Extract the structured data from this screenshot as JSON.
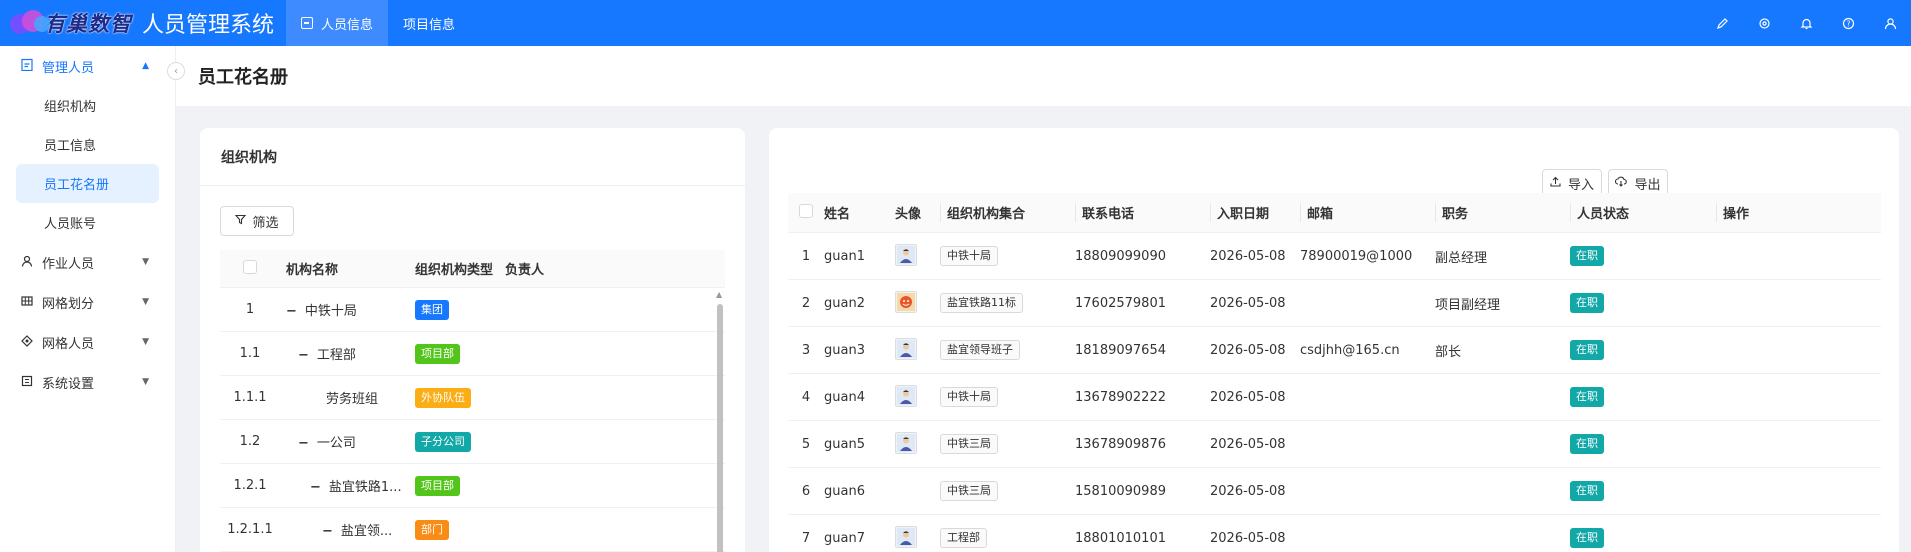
{
  "header": {
    "logo_text": "有巢数智",
    "app_title": "人员管理系统",
    "tabs": [
      {
        "label": "人员信息",
        "active": true
      },
      {
        "label": "项目信息",
        "active": false
      }
    ],
    "icons": [
      "pen-icon",
      "gear-icon",
      "bell-icon",
      "help-icon",
      "user-icon"
    ]
  },
  "sidebar": {
    "groups": [
      {
        "label": "管理人员",
        "icon": "clipboard-icon",
        "open": true,
        "items": [
          {
            "label": "组织机构",
            "active": false
          },
          {
            "label": "员工信息",
            "active": false
          },
          {
            "label": "员工花名册",
            "active": true
          },
          {
            "label": "人员账号",
            "active": false
          }
        ]
      },
      {
        "label": "作业人员",
        "icon": "person-icon",
        "open": false
      },
      {
        "label": "网格划分",
        "icon": "grid-icon",
        "open": false
      },
      {
        "label": "网格人员",
        "icon": "network-icon",
        "open": false
      },
      {
        "label": "系统设置",
        "icon": "settings-icon",
        "open": false
      }
    ]
  },
  "page": {
    "title": "员工花名册"
  },
  "org_panel": {
    "title": "组织机构",
    "filter_label": "筛选",
    "columns": [
      "机构名称",
      "组织机构类型",
      "负责人"
    ],
    "rows": [
      {
        "index": "1",
        "name": "中铁十局",
        "level": 0,
        "expandable": true,
        "type": "集团",
        "type_color": "#1677ff",
        "owner": ""
      },
      {
        "index": "1.1",
        "name": "工程部",
        "level": 1,
        "expandable": true,
        "type": "项目部",
        "type_color": "#52c41a",
        "owner": ""
      },
      {
        "index": "1.1.1",
        "name": "劳务班组",
        "level": 2,
        "expandable": false,
        "type": "外协队伍",
        "type_color": "#faad14",
        "owner": ""
      },
      {
        "index": "1.2",
        "name": "一公司",
        "level": 1,
        "expandable": true,
        "type": "子分公司",
        "type_color": "#13a8a8",
        "owner": ""
      },
      {
        "index": "1.2.1",
        "name": "盐宜铁路1...",
        "level": 2,
        "expandable": true,
        "type": "项目部",
        "type_color": "#52c41a",
        "owner": ""
      },
      {
        "index": "1.2.1.1",
        "name": "盐宜领...",
        "level": 3,
        "expandable": true,
        "type": "部门",
        "type_color": "#fa8c16",
        "owner": ""
      }
    ]
  },
  "employee_panel": {
    "import_label": "导入",
    "export_label": "导出",
    "columns": [
      "姓名",
      "头像",
      "组织机构集合",
      "联系电话",
      "入职日期",
      "邮箱",
      "职务",
      "人员状态",
      "操作"
    ],
    "rows": [
      {
        "no": "1",
        "name": "guan1",
        "avatar": true,
        "avatar_icon": "person-avatar-icon",
        "org": "中铁十局",
        "tel": "18809099090",
        "date": "2026-05-08",
        "email": "78900019@1000",
        "position": "副总经理",
        "status": "在职"
      },
      {
        "no": "2",
        "name": "guan2",
        "avatar": true,
        "avatar_icon": "cartoon-avatar-icon",
        "org": "盐宜铁路11标",
        "tel": "17602579801",
        "date": "2026-05-08",
        "email": "",
        "position": "项目副经理",
        "status": "在职"
      },
      {
        "no": "3",
        "name": "guan3",
        "avatar": true,
        "avatar_icon": "person-avatar-icon",
        "org": "盐宜领导班子",
        "tel": "18189097654",
        "date": "2026-05-08",
        "email": "csdjhh@165.cn",
        "position": "部长",
        "status": "在职"
      },
      {
        "no": "4",
        "name": "guan4",
        "avatar": true,
        "avatar_icon": "person-avatar-icon",
        "org": "中铁十局",
        "tel": "13678902222",
        "date": "2026-05-08",
        "email": "",
        "position": "",
        "status": "在职"
      },
      {
        "no": "5",
        "name": "guan5",
        "avatar": true,
        "avatar_icon": "person-avatar-icon",
        "org": "中铁三局",
        "tel": "13678909876",
        "date": "2026-05-08",
        "email": "",
        "position": "",
        "status": "在职"
      },
      {
        "no": "6",
        "name": "guan6",
        "avatar": false,
        "avatar_icon": "",
        "org": "中铁三局",
        "tel": "15810090989",
        "date": "2026-05-08",
        "email": "",
        "position": "",
        "status": "在职"
      },
      {
        "no": "7",
        "name": "guan7",
        "avatar": true,
        "avatar_icon": "person-avatar-icon",
        "org": "工程部",
        "tel": "18801010101",
        "date": "2026-05-08",
        "email": "",
        "position": "",
        "status": "在职"
      }
    ],
    "status_color": "#13a8a8"
  }
}
